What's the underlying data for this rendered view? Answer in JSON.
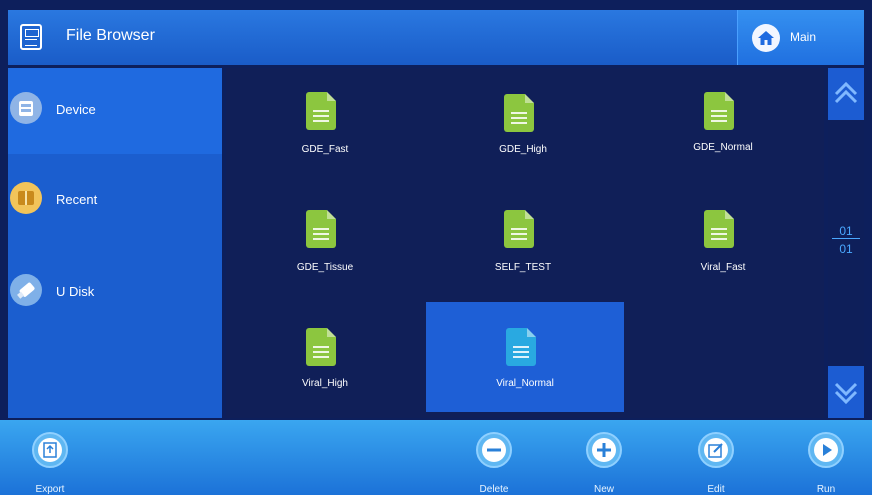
{
  "header": {
    "title": "File Browser",
    "main_label": "Main"
  },
  "sidebar": {
    "items": [
      {
        "label": "Device",
        "icon": "device-icon",
        "active": true
      },
      {
        "label": "Recent",
        "icon": "recent-icon",
        "active": false
      },
      {
        "label": "U Disk",
        "icon": "usb-disk-icon",
        "active": false
      }
    ]
  },
  "files": [
    {
      "name": "GDE_Fast",
      "selected": false
    },
    {
      "name": "GDE_High",
      "selected": false
    },
    {
      "name": "GDE_Normal",
      "selected": false
    },
    {
      "name": "GDE_Tissue",
      "selected": false
    },
    {
      "name": "SELF_TEST",
      "selected": false
    },
    {
      "name": "Viral_Fast",
      "selected": false
    },
    {
      "name": "Viral_High",
      "selected": false
    },
    {
      "name": "Viral_Normal",
      "selected": true
    }
  ],
  "pager": {
    "current": "01",
    "total": "01"
  },
  "footer": {
    "export_label": "Export",
    "delete_label": "Delete",
    "new_label": "New",
    "edit_label": "Edit",
    "run_label": "Run"
  },
  "colors": {
    "file_icon": "#8cc63f",
    "file_icon_selected": "#29a9e1",
    "accent": "#1e6ae0"
  }
}
